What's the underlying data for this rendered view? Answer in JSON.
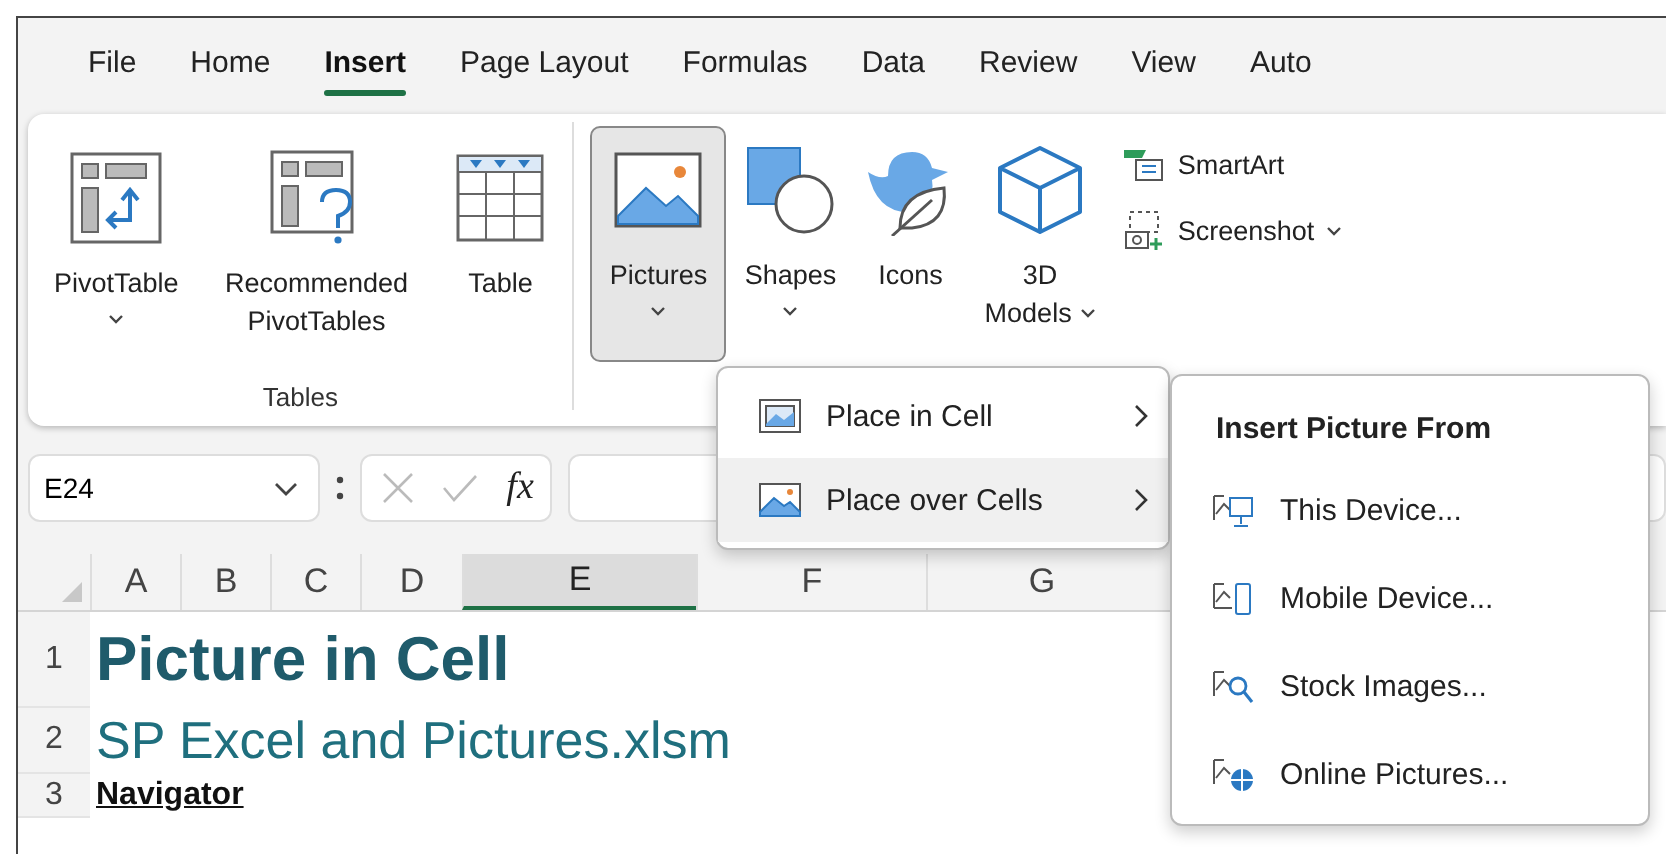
{
  "tabs": [
    {
      "label": "File",
      "selected": false
    },
    {
      "label": "Home",
      "selected": false
    },
    {
      "label": "Insert",
      "selected": true
    },
    {
      "label": "Page Layout",
      "selected": false
    },
    {
      "label": "Formulas",
      "selected": false
    },
    {
      "label": "Data",
      "selected": false
    },
    {
      "label": "Review",
      "selected": false
    },
    {
      "label": "View",
      "selected": false
    },
    {
      "label": "Auto",
      "selected": false
    }
  ],
  "ribbon": {
    "groups": [
      {
        "label": "Tables",
        "buttons": [
          {
            "label": "PivotTable",
            "dropdown": true,
            "pressed": false
          },
          {
            "label": "Recommended PivotTables",
            "dropdown": false,
            "pressed": false
          },
          {
            "label": "Table",
            "dropdown": false,
            "pressed": false
          }
        ]
      },
      {
        "buttons": [
          {
            "label": "Pictures",
            "dropdown": true,
            "pressed": true
          },
          {
            "label": "Shapes",
            "dropdown": true,
            "pressed": false
          },
          {
            "label": "Icons",
            "dropdown": false,
            "pressed": false
          },
          {
            "label": "3D Models",
            "dropdown": true,
            "pressed": false
          }
        ],
        "small_buttons": [
          {
            "label": "SmartArt",
            "dropdown": false
          },
          {
            "label": "Screenshot",
            "dropdown": true
          }
        ]
      }
    ]
  },
  "formula_bar": {
    "name_box": "E24",
    "function_label": "fx"
  },
  "grid": {
    "columns": [
      {
        "label": "A",
        "selected": false
      },
      {
        "label": "B",
        "selected": false
      },
      {
        "label": "C",
        "selected": false
      },
      {
        "label": "D",
        "selected": false
      },
      {
        "label": "E",
        "selected": true
      },
      {
        "label": "F",
        "selected": false
      },
      {
        "label": "G",
        "selected": false
      }
    ],
    "rows": [
      {
        "header": "1",
        "kind": "title",
        "text": "Picture in Cell"
      },
      {
        "header": "2",
        "kind": "subtitle",
        "text": "SP Excel and Pictures.xlsm"
      },
      {
        "header": "3",
        "kind": "heading",
        "text": "Navigator"
      }
    ]
  },
  "menu": {
    "items": [
      {
        "label": "Place in Cell",
        "selected": false
      },
      {
        "label": "Place over Cells",
        "selected": true
      }
    ]
  },
  "submenu": {
    "title": "Insert Picture From",
    "items": [
      {
        "label": "This Device..."
      },
      {
        "label": "Mobile Device..."
      },
      {
        "label": "Stock Images..."
      },
      {
        "label": "Online Pictures..."
      }
    ]
  }
}
